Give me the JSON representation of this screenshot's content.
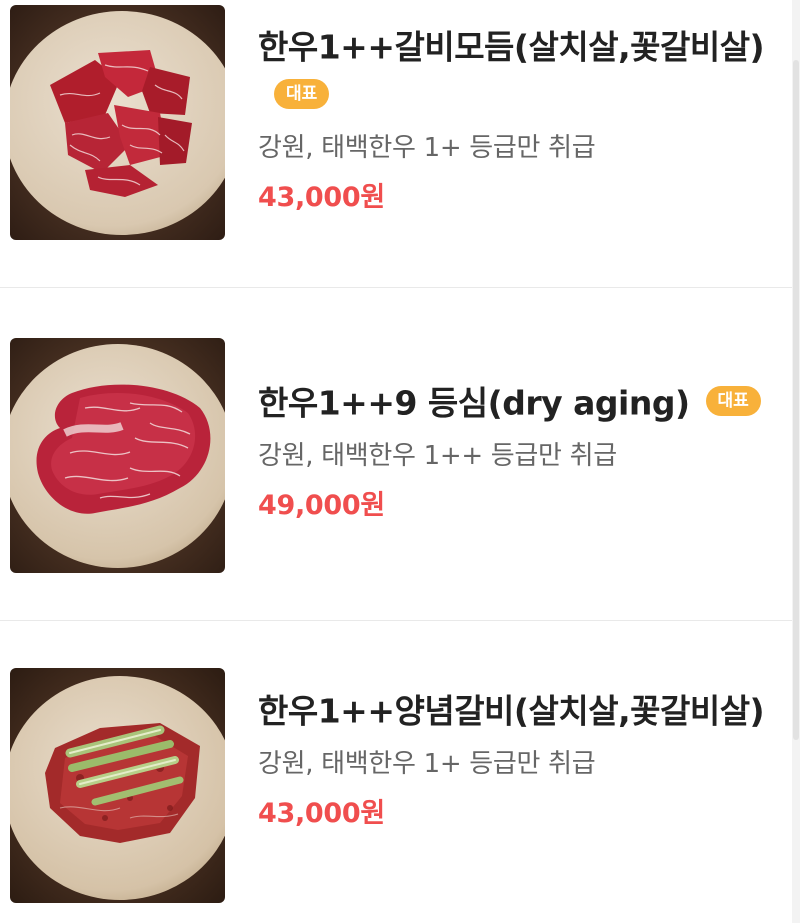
{
  "menu": {
    "items": [
      {
        "name": "한우1++갈비모듬(살치살,꽃갈비살)",
        "badge": "대표",
        "description": "강원, 태백한우 1+ 등급만 취급",
        "price": "43,000원",
        "image_icon": "marbled-beef-cubes-icon"
      },
      {
        "name": "한우1++9 등심(dry aging)",
        "badge": "대표",
        "description": "강원, 태백한우 1++ 등급만 취급",
        "price": "49,000원",
        "image_icon": "sirloin-steak-icon"
      },
      {
        "name": "한우1++양념갈비(살치살,꽃갈비살)",
        "badge": "",
        "description": "강원, 태백한우 1+ 등급만 취급",
        "price": "43,000원",
        "image_icon": "marinated-ribs-icon"
      }
    ]
  },
  "colors": {
    "badge": "#f8b13a",
    "price": "#f04e4e",
    "title": "#222222",
    "description": "#666666"
  }
}
